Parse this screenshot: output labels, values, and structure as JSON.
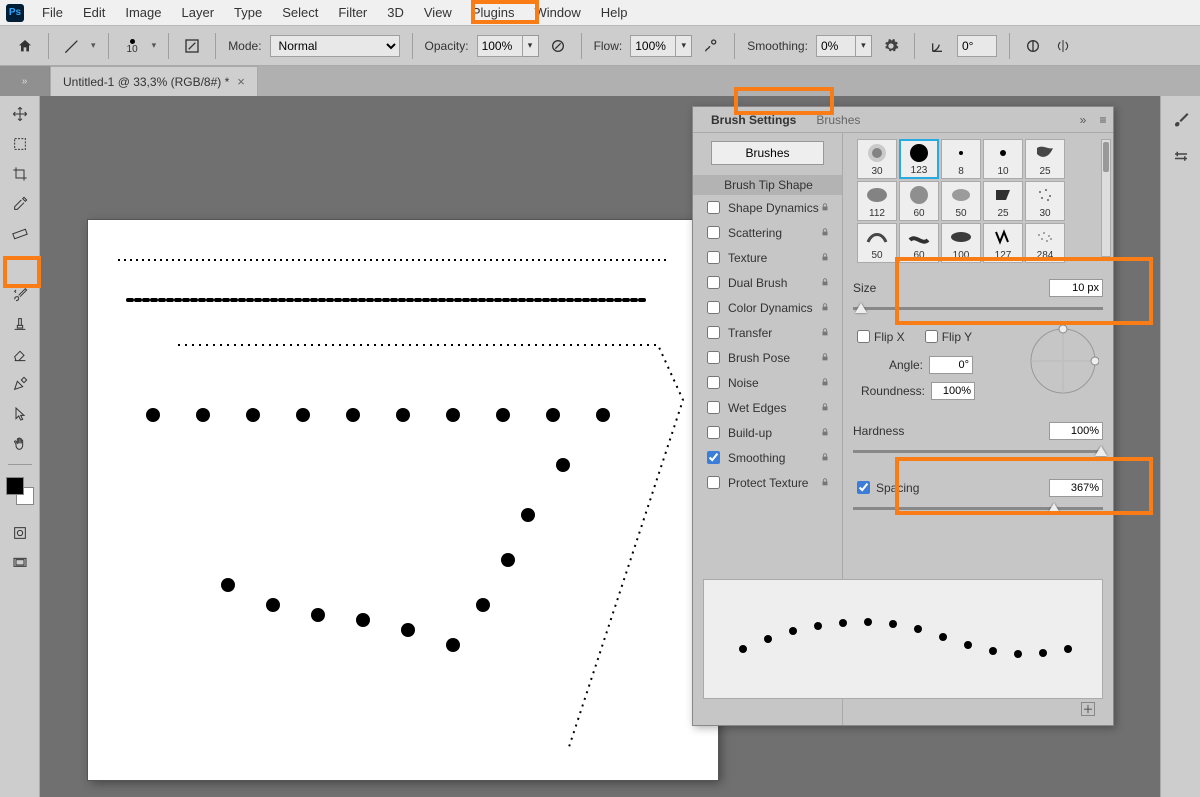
{
  "menu": {
    "items": [
      "File",
      "Edit",
      "Image",
      "Layer",
      "Type",
      "Select",
      "Filter",
      "3D",
      "View",
      "Plugins",
      "Window",
      "Help"
    ]
  },
  "options": {
    "brush_size_preview": "10",
    "mode_label": "Mode:",
    "mode_value": "Normal",
    "opacity_label": "Opacity:",
    "opacity_value": "100%",
    "flow_label": "Flow:",
    "flow_value": "100%",
    "smoothing_label": "Smoothing:",
    "smoothing_value": "0%",
    "angle_value": "0°"
  },
  "document": {
    "tab_title": "Untitled-1 @ 33,3% (RGB/8#) *"
  },
  "panel": {
    "tab_active": "Brush Settings",
    "tab_inactive": "Brushes",
    "brushes_btn": "Brushes",
    "tip_shape": "Brush Tip Shape",
    "options": [
      {
        "label": "Shape Dynamics",
        "checked": false
      },
      {
        "label": "Scattering",
        "checked": false
      },
      {
        "label": "Texture",
        "checked": false
      },
      {
        "label": "Dual Brush",
        "checked": false
      },
      {
        "label": "Color Dynamics",
        "checked": false
      },
      {
        "label": "Transfer",
        "checked": false
      },
      {
        "label": "Brush Pose",
        "checked": false
      },
      {
        "label": "Noise",
        "checked": false
      },
      {
        "label": "Wet Edges",
        "checked": false
      },
      {
        "label": "Build-up",
        "checked": false
      },
      {
        "label": "Smoothing",
        "checked": true
      },
      {
        "label": "Protect Texture",
        "checked": false
      }
    ],
    "thumbs": [
      "30",
      "123",
      "8",
      "10",
      "25",
      "112",
      "60",
      "50",
      "25",
      "30",
      "50",
      "60",
      "100",
      "127",
      "284"
    ],
    "size_label": "Size",
    "size_value": "10 px",
    "flipx_label": "Flip X",
    "flipy_label": "Flip Y",
    "angle_label": "Angle:",
    "angle_value": "0°",
    "roundness_label": "Roundness:",
    "roundness_value": "100%",
    "hardness_label": "Hardness",
    "hardness_value": "100%",
    "spacing_label": "Spacing",
    "spacing_value": "367%"
  }
}
